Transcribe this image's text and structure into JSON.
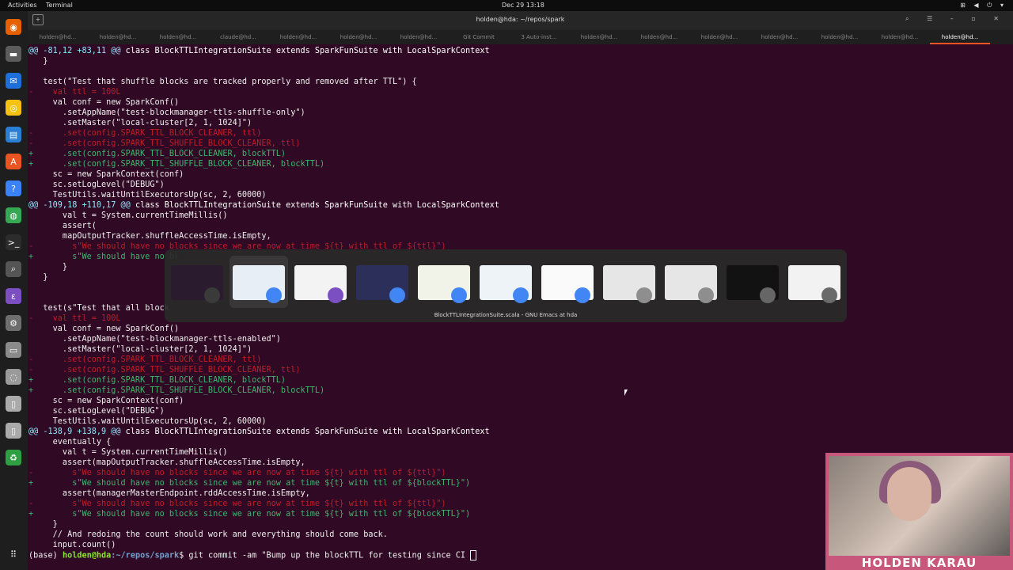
{
  "topbar": {
    "activities": "Activities",
    "app": "Terminal",
    "clock": "Dec 29  13:18",
    "tray": "⊞ ◀ ⏻ ▾"
  },
  "window": {
    "title": "holden@hda: ~/repos/spark",
    "controls": "⌕ ☰ – ▫ ✕"
  },
  "tabs": [
    "holden@hd...",
    "holden@hd...",
    "holden@hd...",
    "claude@hd...",
    "holden@hd...",
    "holden@hd...",
    "holden@hd...",
    "Git Commit",
    "3 Auto-inst...",
    "holden@hd...",
    "holden@hd...",
    "holden@hd...",
    "holden@hd...",
    "holden@hd...",
    "holden@hd...",
    "holden@hd..."
  ],
  "active_tab_index": 15,
  "terminal": {
    "lines": [
      {
        "t": "hunk",
        "a": "@@ -81,12 +83,11 @@",
        "b": " class BlockTTLIntegrationSuite extends SparkFunSuite with LocalSparkContext"
      },
      {
        "t": "ctx",
        "s": "   }"
      },
      {
        "t": "ctx",
        "s": ""
      },
      {
        "t": "ctx",
        "s": "   test(\"Test that shuffle blocks are tracked properly and removed after TTL\") {"
      },
      {
        "t": "del",
        "s": "-    val ttl = 100L"
      },
      {
        "t": "ctx",
        "s": "     val conf = new SparkConf()"
      },
      {
        "t": "ctx",
        "s": "       .setAppName(\"test-blockmanager-ttls-shuffle-only\")"
      },
      {
        "t": "ctx",
        "s": "       .setMaster(\"local-cluster[2, 1, 1024]\")"
      },
      {
        "t": "del",
        "s": "-      .set(config.SPARK_TTL_BLOCK_CLEANER, ttl)"
      },
      {
        "t": "del",
        "s": "-      .set(config.SPARK_TTL_SHUFFLE_BLOCK_CLEANER, ttl)"
      },
      {
        "t": "add",
        "s": "+      .set(config.SPARK_TTL_BLOCK_CLEANER, blockTTL)"
      },
      {
        "t": "add",
        "s": "+      .set(config.SPARK_TTL_SHUFFLE_BLOCK_CLEANER, blockTTL)"
      },
      {
        "t": "ctx",
        "s": "     sc = new SparkContext(conf)"
      },
      {
        "t": "ctx",
        "s": "     sc.setLogLevel(\"DEBUG\")"
      },
      {
        "t": "ctx",
        "s": "     TestUtils.waitUntilExecutorsUp(sc, 2, 60000)"
      },
      {
        "t": "hunk",
        "a": "@@ -109,18 +110,17 @@",
        "b": " class BlockTTLIntegrationSuite extends SparkFunSuite with LocalSparkContext"
      },
      {
        "t": "ctx",
        "s": "       val t = System.currentTimeMillis()"
      },
      {
        "t": "ctx",
        "s": "       assert("
      },
      {
        "t": "ctx",
        "s": "       mapOutputTracker.shuffleAccessTime.isEmpty,"
      },
      {
        "t": "del",
        "s": "-        s\"We should have no blocks since we are now at time ${t} with ttl of ${ttl}\")"
      },
      {
        "t": "add",
        "s": "+        s\"We should have no bl"
      },
      {
        "t": "ctx",
        "s": "       }"
      },
      {
        "t": "ctx",
        "s": "   }"
      },
      {
        "t": "ctx",
        "s": ""
      },
      {
        "t": "ctx",
        "s": ""
      },
      {
        "t": "ctx",
        "s": "   test(s\"Test that all block"
      },
      {
        "t": "del",
        "s": "-    val ttl = 100L"
      },
      {
        "t": "ctx",
        "s": "     val conf = new SparkConf()"
      },
      {
        "t": "ctx",
        "s": "       .setAppName(\"test-blockmanager-ttls-enabled\")"
      },
      {
        "t": "ctx",
        "s": "       .setMaster(\"local-cluster[2, 1, 1024]\")"
      },
      {
        "t": "del",
        "s": "-      .set(config.SPARK_TTL_BLOCK_CLEANER, ttl)"
      },
      {
        "t": "del",
        "s": "-      .set(config.SPARK_TTL_SHUFFLE_BLOCK_CLEANER, ttl)"
      },
      {
        "t": "add",
        "s": "+      .set(config.SPARK_TTL_BLOCK_CLEANER, blockTTL)"
      },
      {
        "t": "add",
        "s": "+      .set(config.SPARK_TTL_SHUFFLE_BLOCK_CLEANER, blockTTL)"
      },
      {
        "t": "ctx",
        "s": "     sc = new SparkContext(conf)"
      },
      {
        "t": "ctx",
        "s": "     sc.setLogLevel(\"DEBUG\")"
      },
      {
        "t": "ctx",
        "s": "     TestUtils.waitUntilExecutorsUp(sc, 2, 60000)"
      },
      {
        "t": "hunk",
        "a": "@@ -138,9 +138,9 @@",
        "b": " class BlockTTLIntegrationSuite extends SparkFunSuite with LocalSparkContext"
      },
      {
        "t": "ctx",
        "s": "     eventually {"
      },
      {
        "t": "ctx",
        "s": "       val t = System.currentTimeMillis()"
      },
      {
        "t": "ctx",
        "s": "       assert(mapOutputTracker.shuffleAccessTime.isEmpty,"
      },
      {
        "t": "del",
        "s": "-        s\"We should have no blocks since we are now at time ${t} with ttl of ${ttl}\")"
      },
      {
        "t": "add",
        "s": "+        s\"We should have no blocks since we are now at time ${t} with ttl of ${blockTTL}\")"
      },
      {
        "t": "ctx",
        "s": "       assert(managerMasterEndpoint.rddAccessTime.isEmpty,"
      },
      {
        "t": "del",
        "s": "-        s\"We should have no blocks since we are now at time ${t} with ttl of ${ttl}\")"
      },
      {
        "t": "add",
        "s": "+        s\"We should have no blocks since we are now at time ${t} with ttl of ${blockTTL}\")"
      },
      {
        "t": "ctx",
        "s": "     }"
      },
      {
        "t": "ctx",
        "s": "     // And redoing the count should work and everything should come back."
      },
      {
        "t": "ctx",
        "s": "     input.count()"
      }
    ],
    "prompt": {
      "env": "(base) ",
      "user": "holden@hda",
      "path": ":~/repos/spark",
      "cmd": "$ git commit -am \"Bump up the blockTTL for testing since CI "
    }
  },
  "switcher": {
    "caption": "BlockTTLIntegrationSuite.scala - GNU Emacs at hda",
    "windows": [
      {
        "name": "terminal-window",
        "app": "terminal-icon",
        "thumb": "#2a1b2e",
        "badge": "#3a3a3a"
      },
      {
        "name": "chrome-window-1",
        "app": "chrome-icon",
        "thumb": "#e8eef5",
        "badge": "#4285f4"
      },
      {
        "name": "emacs-window",
        "app": "emacs-icon",
        "thumb": "#f3f3f3",
        "badge": "#7b4fc2"
      },
      {
        "name": "chrome-window-2",
        "app": "chrome-icon",
        "thumb": "#2b2f5a",
        "badge": "#4285f4"
      },
      {
        "name": "chrome-window-3",
        "app": "chrome-icon",
        "thumb": "#f1f3e8",
        "badge": "#4285f4"
      },
      {
        "name": "chrome-window-4",
        "app": "chrome-icon",
        "thumb": "#eef3f8",
        "badge": "#4285f4"
      },
      {
        "name": "chrome-window-5",
        "app": "chrome-icon",
        "thumb": "#fafafa",
        "badge": "#4285f4"
      },
      {
        "name": "files-window-1",
        "app": "files-icon",
        "thumb": "#e6e6e6",
        "badge": "#8e8e8e"
      },
      {
        "name": "files-window-2",
        "app": "files-icon",
        "thumb": "#e6e6e6",
        "badge": "#8e8e8e"
      },
      {
        "name": "screenshot-window",
        "app": "magnifier-icon",
        "thumb": "#121212",
        "badge": "#666666"
      },
      {
        "name": "settings-window",
        "app": "settings-icon",
        "thumb": "#f2f2f2",
        "badge": "#6a6a6a"
      }
    ]
  },
  "dock": [
    {
      "name": "firefox-icon",
      "color": "#e66000",
      "glyph": "◉"
    },
    {
      "name": "files-icon",
      "color": "#5b5b5b",
      "glyph": "▬"
    },
    {
      "name": "thunderbird-icon",
      "color": "#1e6fd9",
      "glyph": "✉"
    },
    {
      "name": "rhythmbox-icon",
      "color": "#f5c211",
      "glyph": "◎"
    },
    {
      "name": "writer-icon",
      "color": "#2a7fd4",
      "glyph": "▤"
    },
    {
      "name": "software-icon",
      "color": "#e95420",
      "glyph": "A"
    },
    {
      "name": "help-icon",
      "color": "#3b82f6",
      "glyph": "?"
    },
    {
      "name": "chrome-icon",
      "color": "#34a853",
      "glyph": "◍"
    },
    {
      "name": "terminal-icon",
      "color": "#2c2c2c",
      "glyph": ">_"
    },
    {
      "name": "screenshot-icon",
      "color": "#555555",
      "glyph": "⌕"
    },
    {
      "name": "emacs-icon",
      "color": "#7b4fc2",
      "glyph": "ε"
    },
    {
      "name": "settings-icon",
      "color": "#6e6e6e",
      "glyph": "⚙"
    },
    {
      "name": "ssd-icon",
      "color": "#8a8a8a",
      "glyph": "▭"
    },
    {
      "name": "disk-icon",
      "color": "#9a9a9a",
      "glyph": "◌"
    },
    {
      "name": "usb-icon",
      "color": "#aaaaaa",
      "glyph": "▯"
    },
    {
      "name": "usb-icon-2",
      "color": "#aaaaaa",
      "glyph": "▯"
    },
    {
      "name": "trash-icon",
      "color": "#2ea043",
      "glyph": "♻"
    }
  ],
  "webcam": {
    "name": "HOLDEN KARAU",
    "border": "#c7577b"
  }
}
